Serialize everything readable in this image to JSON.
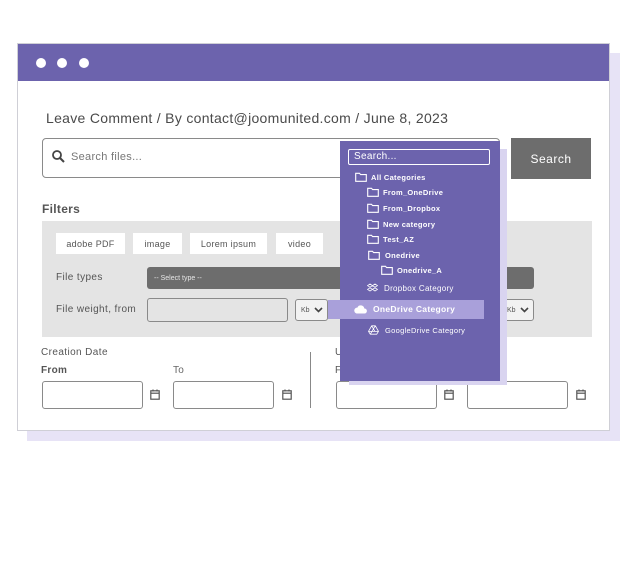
{
  "post_meta": "Leave Comment / By contact@joomunited.com / June 8, 2023",
  "search": {
    "placeholder": "Search files...",
    "button": "Search"
  },
  "filters": {
    "title": "Filters",
    "tags": [
      "adobe PDF",
      "image",
      "Lorem ipsum",
      "video"
    ],
    "file_types_label": "File types",
    "file_type_select": "-- Select type --",
    "file_weight_label": "File weight, from",
    "unit_min": "Kb",
    "unit_max": "Kb"
  },
  "dates": {
    "creation_label": "Creation Date",
    "from": "From",
    "to": "To",
    "update_label_partial": "U",
    "update_from_partial": "F"
  },
  "dropdown": {
    "search_placeholder": "Search...",
    "items": [
      {
        "label": "All Categories",
        "icon": "folder-icon"
      },
      {
        "label": "From_OneDrive",
        "icon": "folder-icon"
      },
      {
        "label": "From_Dropbox",
        "icon": "folder-icon"
      },
      {
        "label": "New category",
        "icon": "folder-icon"
      },
      {
        "label": "Test_AZ",
        "icon": "folder-icon"
      },
      {
        "label": "Onedrive",
        "icon": "folder-icon"
      },
      {
        "label": "Onedrive_A",
        "icon": "folder-icon"
      }
    ],
    "clouds": [
      {
        "label": "Dropbox Category",
        "icon": "dropbox-icon"
      },
      {
        "label": "OneDrive Category",
        "icon": "cloud-icon",
        "active": true
      },
      {
        "label": "GoogleDrive Category",
        "icon": "google-drive-icon"
      }
    ]
  },
  "colors": {
    "accent": "#6c63ad",
    "highlight": "#a9a0da",
    "button": "#6d6d6d"
  }
}
